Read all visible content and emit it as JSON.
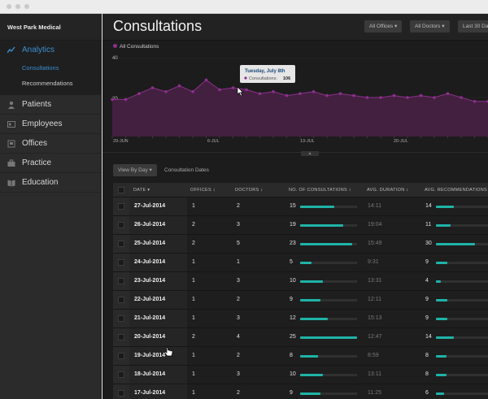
{
  "sidebar": {
    "brand": "West Park Medical",
    "items": [
      {
        "label": "Analytics",
        "icon": "trend-icon",
        "active": true
      },
      {
        "label": "Patients",
        "icon": "person-icon"
      },
      {
        "label": "Employees",
        "icon": "id-card-icon"
      },
      {
        "label": "Offices",
        "icon": "building-icon"
      },
      {
        "label": "Practice",
        "icon": "briefcase-icon"
      },
      {
        "label": "Education",
        "icon": "book-icon"
      }
    ],
    "analytics_sub": [
      {
        "label": "Consultations",
        "active": true
      },
      {
        "label": "Recommendations"
      }
    ]
  },
  "header": {
    "title": "Consultations",
    "filters": [
      "All Offices ▾",
      "All Doctors ▾",
      "Last 30 Da"
    ]
  },
  "chart_data": {
    "type": "area",
    "legend": "All Consultations",
    "y_ticks": [
      "40",
      "20"
    ],
    "ylim": [
      0,
      40
    ],
    "x_tick_labels": [
      "29-JUN",
      "6-JUL",
      "13-JUL",
      "20-JUL"
    ],
    "values": [
      19,
      19,
      22,
      25,
      23,
      26,
      23,
      29,
      24,
      25,
      24,
      22,
      23,
      21,
      22,
      23,
      21,
      22,
      21,
      20,
      20,
      21,
      20,
      21,
      20,
      22,
      20,
      18,
      18,
      19,
      17,
      19,
      20,
      20,
      19,
      20,
      20
    ],
    "tooltip": {
      "title": "Tuesday, July 8th",
      "series": "Consultations:",
      "value": "106"
    },
    "colors": {
      "line": "#8d2f8d",
      "fill": "#43203f"
    }
  },
  "toolbar": {
    "view_by": "View By Day ▾",
    "dates_label": "Consultation Dates"
  },
  "table": {
    "headers": {
      "date": "DATE ▾",
      "offices": "OFFICES ↕",
      "doctors": "DOCTORS ↕",
      "consultations": "NO. OF CONSULTATIONS ↕",
      "duration": "AVG. DURATION ↕",
      "recommendations": "AVG. RECOMMENDATIONS ↕"
    },
    "rows": [
      {
        "date": "27-Jul-2014",
        "offices": "1",
        "doctors": "2",
        "consultations": "15",
        "duration": "14:11",
        "recommendations": "14"
      },
      {
        "date": "26-Jul-2014",
        "offices": "2",
        "doctors": "3",
        "consultations": "19",
        "duration": "19:04",
        "recommendations": "11"
      },
      {
        "date": "25-Jul-2014",
        "offices": "2",
        "doctors": "5",
        "consultations": "23",
        "duration": "15:49",
        "recommendations": "30"
      },
      {
        "date": "24-Jul-2014",
        "offices": "1",
        "doctors": "1",
        "consultations": "5",
        "duration": "9:31",
        "recommendations": "9"
      },
      {
        "date": "23-Jul-2014",
        "offices": "1",
        "doctors": "3",
        "consultations": "10",
        "duration": "13:31",
        "recommendations": "4"
      },
      {
        "date": "22-Jul-2014",
        "offices": "1",
        "doctors": "2",
        "consultations": "9",
        "duration": "12:11",
        "recommendations": "9"
      },
      {
        "date": "21-Jul-2014",
        "offices": "1",
        "doctors": "3",
        "consultations": "12",
        "duration": "15:13",
        "recommendations": "9"
      },
      {
        "date": "20-Jul-2014",
        "offices": "2",
        "doctors": "4",
        "consultations": "25",
        "duration": "12:47",
        "recommendations": "14"
      },
      {
        "date": "19-Jul-2014",
        "offices": "1",
        "doctors": "2",
        "consultations": "8",
        "duration": "8:59",
        "recommendations": "8"
      },
      {
        "date": "18-Jul-2014",
        "offices": "1",
        "doctors": "3",
        "consultations": "10",
        "duration": "13:11",
        "recommendations": "8"
      },
      {
        "date": "17-Jul-2014",
        "offices": "1",
        "doctors": "2",
        "consultations": "9",
        "duration": "11:25",
        "recommendations": "6"
      }
    ],
    "bar_color": "#1fb3a8"
  }
}
